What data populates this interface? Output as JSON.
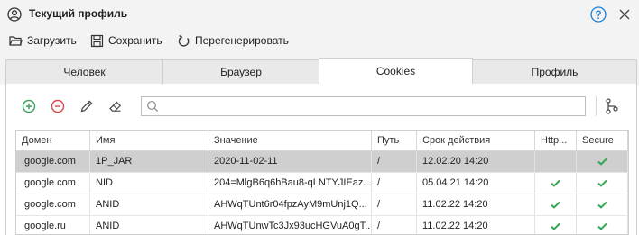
{
  "window": {
    "title": "Текущий профиль"
  },
  "toolbar": {
    "load_label": "Загрузить",
    "save_label": "Сохранить",
    "regenerate_label": "Перегенерировать"
  },
  "tabs": [
    {
      "label": "Человек"
    },
    {
      "label": "Браузер"
    },
    {
      "label": "Cookies"
    },
    {
      "label": "Профиль"
    }
  ],
  "active_tab": "Cookies",
  "search": {
    "value": "",
    "placeholder": ""
  },
  "table": {
    "columns": [
      "Домен",
      "Имя",
      "Значение",
      "Путь",
      "Срок действия",
      "Http...",
      "Secure"
    ],
    "rows": [
      {
        "domain": ".google.com",
        "name": "1P_JAR",
        "value": "2020-11-02-11",
        "path": "/",
        "expires": "12.02.20 14:20",
        "http": false,
        "secure": true,
        "selected": true
      },
      {
        "domain": ".google.com",
        "name": "NID",
        "value": "204=MlgB6q6hBau8-qLNTYJIEaz...",
        "path": "/",
        "expires": "05.04.21 14:20",
        "http": true,
        "secure": true,
        "selected": false
      },
      {
        "domain": ".google.com",
        "name": "ANID",
        "value": "AHWqTUnt6r04fpzAyM9mUnj1Q...",
        "path": "/",
        "expires": "11.02.22 14:20",
        "http": true,
        "secure": true,
        "selected": false
      },
      {
        "domain": ".google.ru",
        "name": "ANID",
        "value": "AHWqTUnwTc3Jx93ucHGVuA0gT...",
        "path": "/",
        "expires": "11.02.22 14:20",
        "http": true,
        "secure": true,
        "selected": false
      }
    ]
  },
  "colors": {
    "add_green": "#3aa55a",
    "remove_red": "#e0424a",
    "check_green": "#2fa84f",
    "help_blue": "#1e7fd6"
  }
}
